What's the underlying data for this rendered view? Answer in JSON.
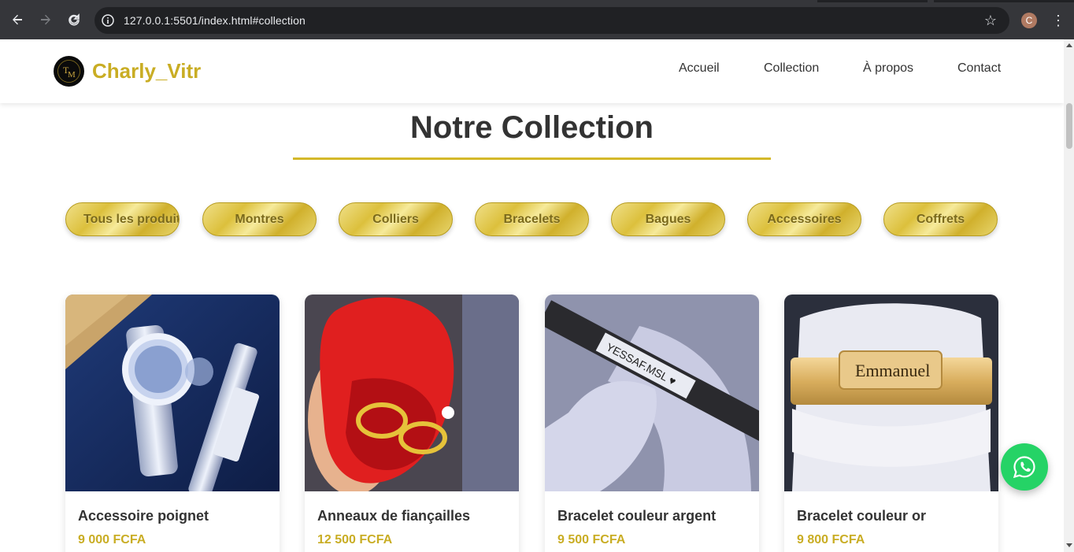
{
  "browser": {
    "url": "127.0.0.1:5501/index.html#collection",
    "profile_initial": "C",
    "back_icon": "arrow-left-icon",
    "forward_icon": "arrow-right-icon",
    "reload_icon": "reload-icon",
    "info_icon": "site-info-icon",
    "bookmark_icon": "star-icon",
    "menu_icon": "kebab-menu-icon"
  },
  "header": {
    "brand": "Charly_Vitr",
    "nav": [
      "Accueil",
      "Collection",
      "À propos",
      "Contact"
    ]
  },
  "collection": {
    "title": "Notre Collection",
    "filters": [
      "Tous les produits",
      "Montres",
      "Colliers",
      "Bracelets",
      "Bagues",
      "Accessoires",
      "Coffrets"
    ],
    "products": [
      {
        "name": "Accessoire poignet",
        "price": "9 000 FCFA"
      },
      {
        "name": "Anneaux de fiançailles",
        "price": "12 500 FCFA"
      },
      {
        "name": "Bracelet couleur argent",
        "price": "9 500 FCFA"
      },
      {
        "name": "Bracelet couleur or",
        "price": "9 800 FCFA"
      }
    ]
  },
  "image_lettering": {
    "bracelet_argent_engraving": "YESSAF.MSL",
    "bracelet_or_engraving": "Emmanuel"
  },
  "colors": {
    "brand_gold": "#c9ad24",
    "whatsapp_green": "#25d366",
    "text_dark": "#333333"
  },
  "floating": {
    "whatsapp_icon": "whatsapp-icon"
  }
}
